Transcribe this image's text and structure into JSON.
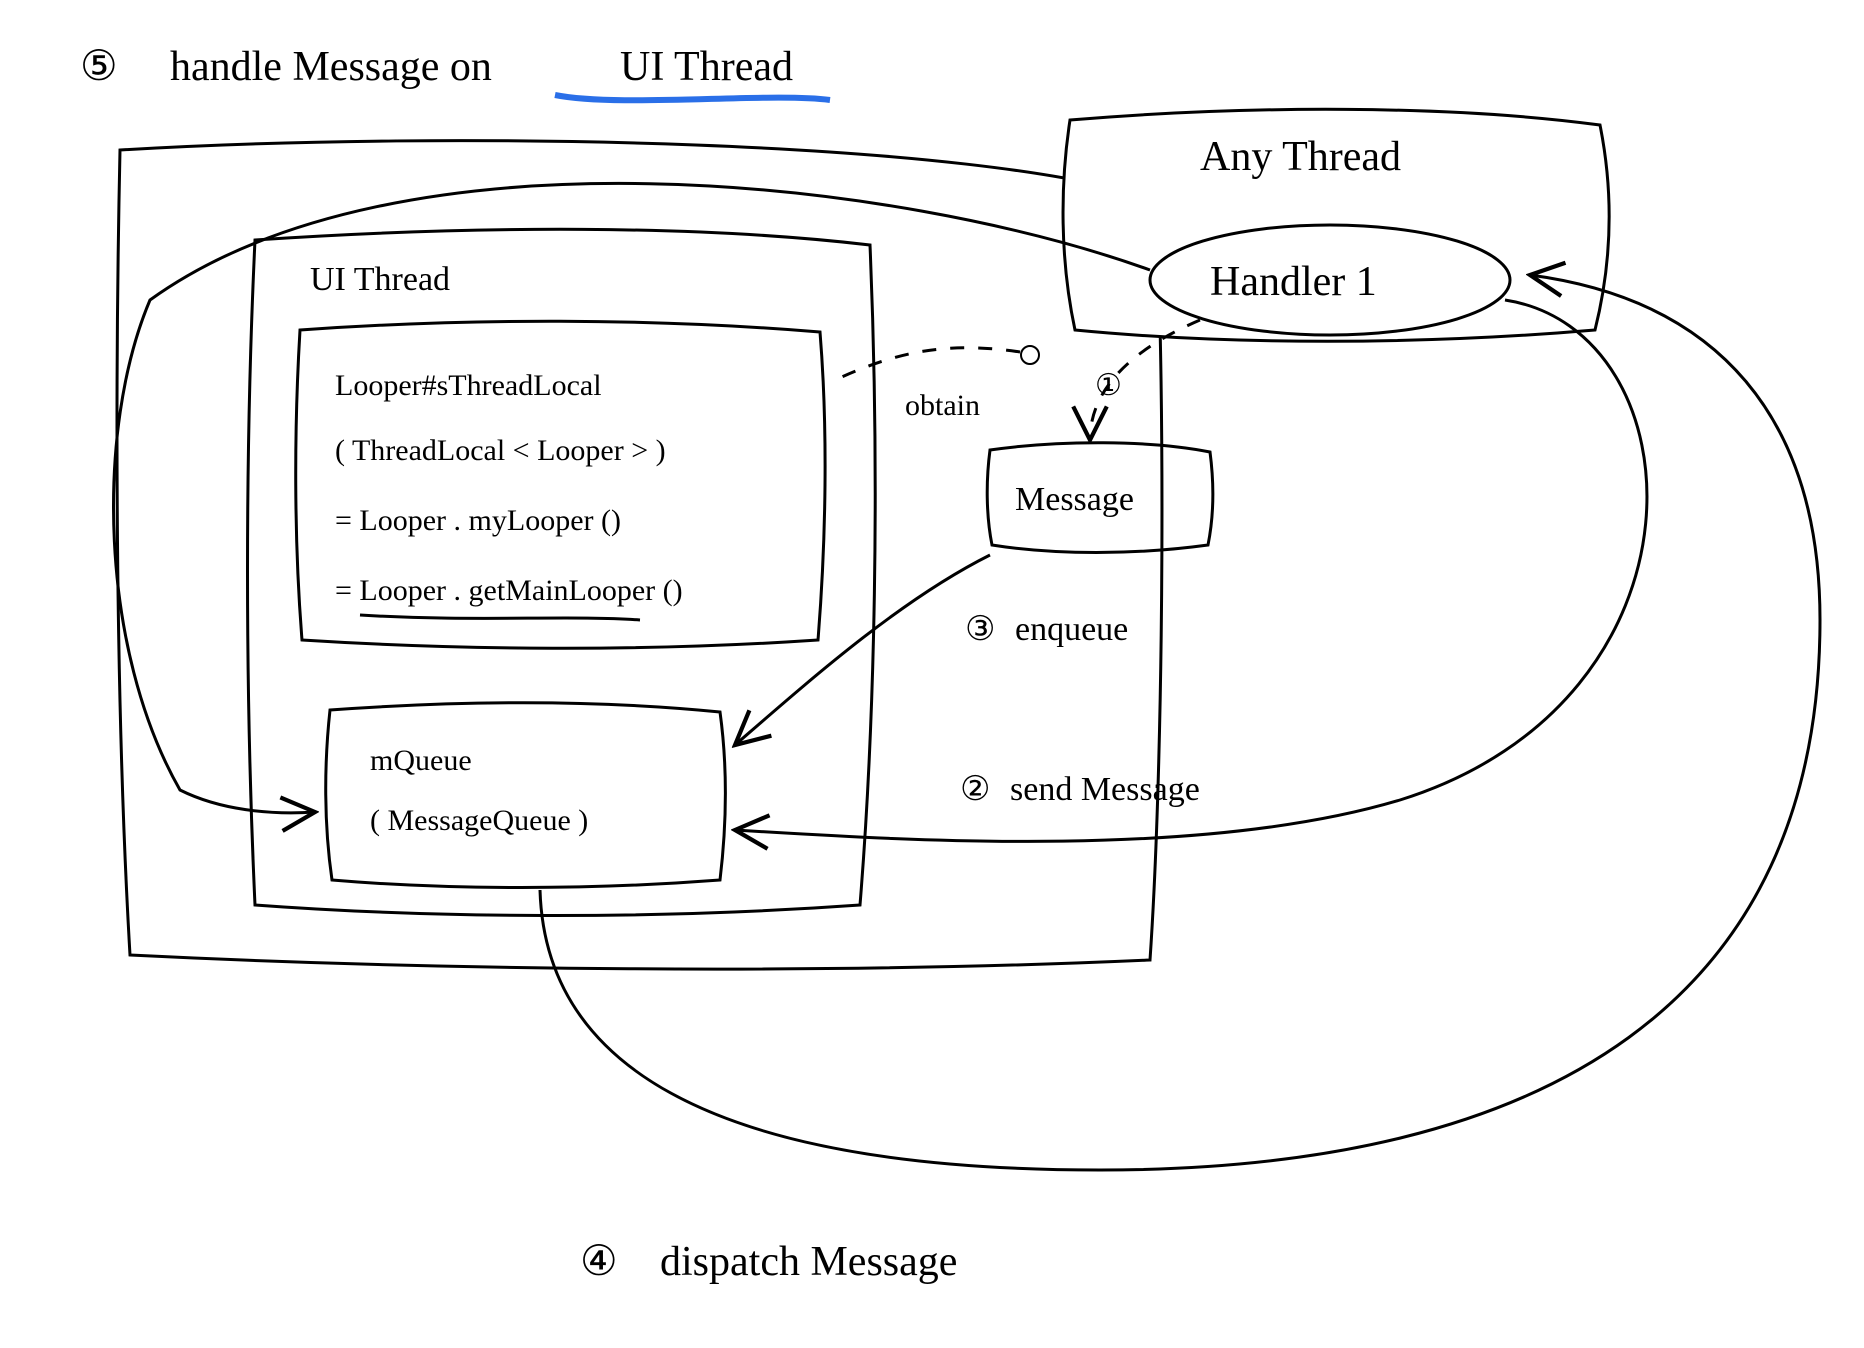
{
  "title": {
    "step_prefix": "⑤",
    "part1": "handle Message on ",
    "part2": "UI Thread"
  },
  "outer_box": {
    "label": ""
  },
  "any_thread": {
    "label": "Any Thread"
  },
  "handler": {
    "label": "Handler 1"
  },
  "ui_thread": {
    "label": "UI Thread"
  },
  "looper_box": {
    "line1": "Looper#sThreadLocal",
    "line2": "( ThreadLocal < Looper > )",
    "line3": "= Looper . myLooper ()",
    "line4": "= Looper . getMainLooper ()"
  },
  "mqueue_box": {
    "line1": "mQueue",
    "line2": "( MessageQueue )"
  },
  "message_box": {
    "label": "Message"
  },
  "steps": {
    "s1": {
      "marker": "①",
      "label": "obtain"
    },
    "s2": {
      "marker": "②",
      "label": "send Message"
    },
    "s3": {
      "marker": "③",
      "label": "enqueue"
    },
    "s4": {
      "marker": "④",
      "label": "dispatch Message"
    }
  }
}
